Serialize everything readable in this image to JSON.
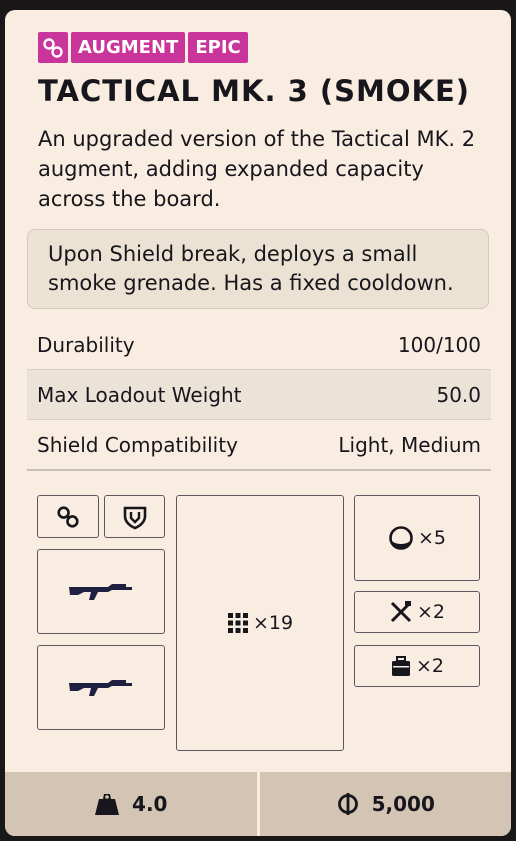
{
  "item": {
    "badges": {
      "type": "AUGMENT",
      "rarity": "EPIC"
    },
    "title": "TACTICAL MK. 3 (SMOKE)",
    "description": "An upgraded version of the Tactical MK. 2 augment, adding expanded capacity across the board.",
    "effect": "Upon Shield break, deploys a small smoke grenade. Has a fixed cooldown."
  },
  "stats": [
    {
      "label": "Durability",
      "value": "100/100"
    },
    {
      "label": "Max Loadout Weight",
      "value": "50.0"
    },
    {
      "label": "Shield Compatibility",
      "value": "Light, Medium"
    }
  ],
  "slots": {
    "backpack": "×19",
    "grenade": "×5",
    "utility": "×2",
    "quick_use": "×2"
  },
  "footer": {
    "weight": "4.0",
    "price": "5,000"
  },
  "colors": {
    "accent": "#c9359a",
    "card": "#f9ede2",
    "footer": "#d3c4b3"
  },
  "icons": [
    "augment-icon",
    "shield-icon",
    "rifle-icon",
    "grid-icon",
    "grenade-icon",
    "tools-icon",
    "case-icon",
    "weight-icon",
    "coin-icon"
  ]
}
